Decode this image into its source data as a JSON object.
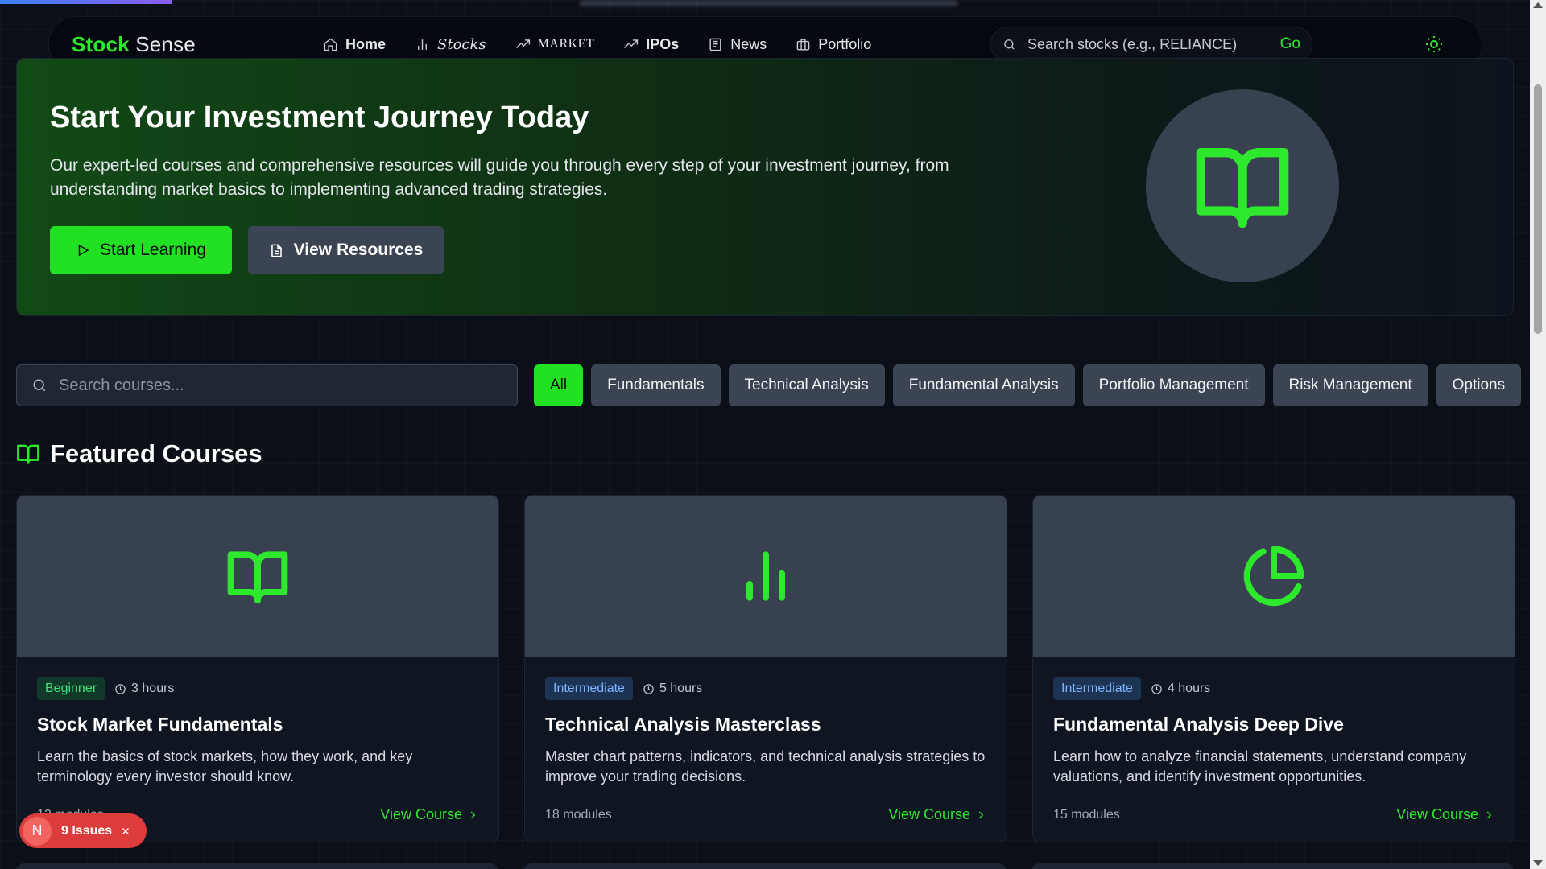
{
  "nav": {
    "logo_part1": "Stock",
    "logo_part2": "Sense",
    "links": [
      {
        "label": "Home",
        "icon": "home-icon"
      },
      {
        "label": "Stocks",
        "icon": "bar-chart-icon"
      },
      {
        "label": "MARKET",
        "icon": "trending-up-icon"
      },
      {
        "label": "IPOs",
        "icon": "trending-up-icon"
      },
      {
        "label": "News",
        "icon": "newspaper-icon"
      },
      {
        "label": "Portfolio",
        "icon": "briefcase-icon"
      }
    ],
    "search_placeholder": "Search stocks (e.g., RELIANCE)",
    "search_go": "Go",
    "theme_icon": "sun-icon"
  },
  "hero": {
    "title": "Start Your Investment Journey Today",
    "description": "Our expert-led courses and comprehensive resources will guide you through every step of your investment journey, from understanding market basics to implementing advanced trading strategies.",
    "primary_button": "Start Learning",
    "secondary_button": "View Resources",
    "illustration_icon": "open-book-icon"
  },
  "filters": {
    "search_placeholder": "Search courses...",
    "categories": [
      "All",
      "Fundamentals",
      "Technical Analysis",
      "Fundamental Analysis",
      "Portfolio Management",
      "Risk Management",
      "Options"
    ],
    "active": "All"
  },
  "featured": {
    "heading": "Featured Courses",
    "courses": [
      {
        "level": "Beginner",
        "duration": "3 hours",
        "title": "Stock Market Fundamentals",
        "description": "Learn the basics of stock markets, how they work, and key terminology every investor should know.",
        "modules": "12 modules",
        "link": "View Course",
        "icon": "open-book-icon"
      },
      {
        "level": "Intermediate",
        "duration": "5 hours",
        "title": "Technical Analysis Masterclass",
        "description": "Master chart patterns, indicators, and technical analysis strategies to improve your trading decisions.",
        "modules": "18 modules",
        "link": "View Course",
        "icon": "bar-chart-icon"
      },
      {
        "level": "Intermediate",
        "duration": "4 hours",
        "title": "Fundamental Analysis Deep Dive",
        "description": "Learn how to analyze financial statements, understand company valuations, and identify investment opportunities.",
        "modules": "15 modules",
        "link": "View Course",
        "icon": "pie-chart-icon"
      }
    ]
  },
  "issues_badge": {
    "initial": "N",
    "label": "9 Issues"
  },
  "colors": {
    "accent": "#22e022",
    "background": "#0b0f17",
    "beginner_badge": "#3ee37a",
    "intermediate_badge": "#7cb4ff",
    "issues_badge": "#dc3c3c"
  }
}
